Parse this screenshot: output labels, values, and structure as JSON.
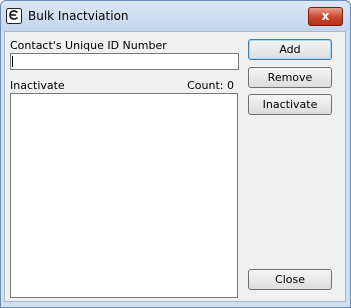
{
  "window": {
    "title": "Bulk Inactviation",
    "close_glyph": "x"
  },
  "form": {
    "id_label": "Contact's Unique ID Number",
    "id_value": "",
    "list_label": "Inactivate",
    "count_label": "Count: 0"
  },
  "buttons": {
    "add": "Add",
    "remove": "Remove",
    "inactivate": "Inactivate",
    "close": "Close"
  },
  "icons": {
    "app_icon": "app-logo-icon",
    "close_icon": "close-icon"
  },
  "colors": {
    "close_button": "#c8462c",
    "titlebar": "#c3d6ec",
    "client_bg": "#f0f0f0"
  }
}
